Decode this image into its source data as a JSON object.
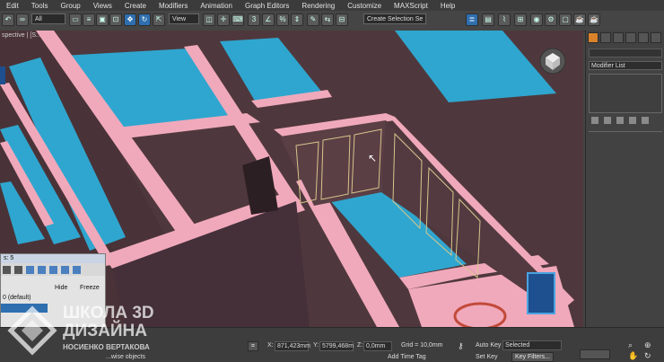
{
  "menu": [
    "Edit",
    "Tools",
    "Group",
    "Views",
    "Create",
    "Modifiers",
    "Animation",
    "Graph Editors",
    "Rendering",
    "Customize",
    "MAXScript",
    "Help"
  ],
  "toolbar": {
    "filter_value": "All",
    "refcoord_value": "View",
    "selection_set_placeholder": "Create Selection Se"
  },
  "viewport": {
    "label": "spective | [S...",
    "accent_wall": "#f0a9bb",
    "floor_color": "#2fa6cf",
    "wall_color": "#5a3f45"
  },
  "command_panel": {
    "modifier_list_label": "Modifier List"
  },
  "layer_dialog": {
    "title": "s: 5",
    "col_hide": "Hide",
    "col_freeze": "Freeze",
    "row_default": "0 (default)"
  },
  "status": {
    "x_label": "X:",
    "x_value": "871,423mm",
    "y_label": "Y:",
    "y_value": "5799,468m",
    "z_label": "Z:",
    "z_value": "0,0mm",
    "grid_label": "Grid = 10,0mm",
    "add_time_tag": "Add Time Tag",
    "auto_key": "Auto Key",
    "auto_key_value": "Selected",
    "set_key": "Set Key",
    "key_filters": "Key Filters...",
    "select_hint": "...wise objects"
  },
  "watermark": {
    "line1": "ШКОЛА 3D",
    "line2": "ДИЗАЙНА",
    "line3": "НОСИЕНКО ВЕРТАКОВА"
  }
}
